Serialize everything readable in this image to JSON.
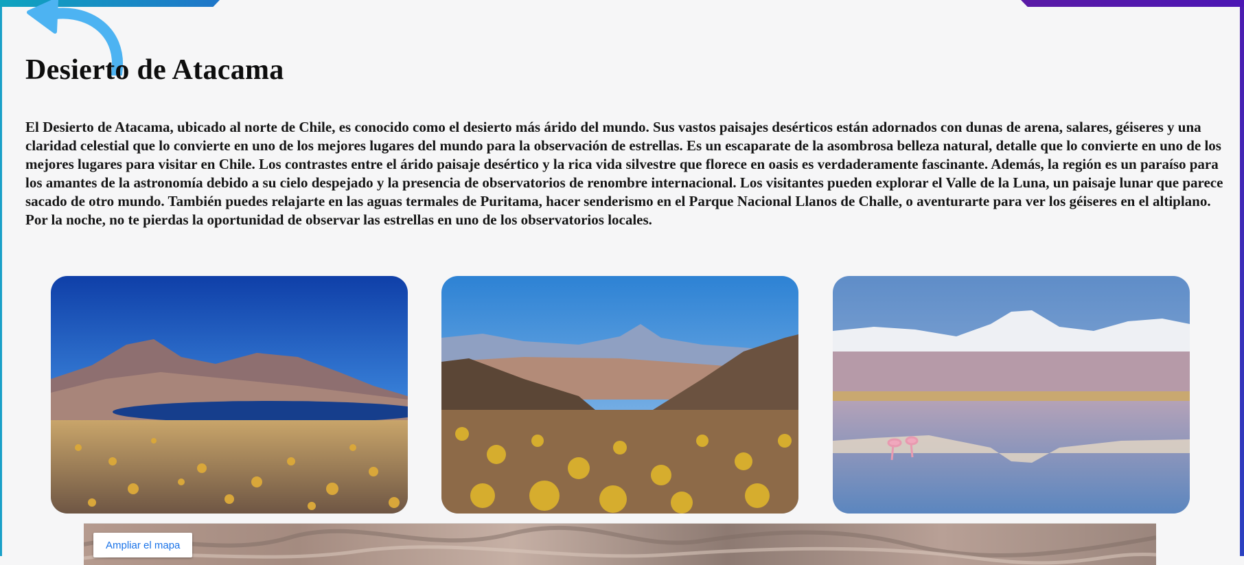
{
  "page": {
    "title": "Desierto de Atacama",
    "description": "El Desierto de Atacama, ubicado al norte de Chile, es conocido como el desierto más árido del mundo. Sus vastos paisajes desérticos están adornados con dunas de arena, salares, géiseres y una claridad celestial que lo convierte en uno de los mejores lugares del mundo para la observación de estrellas. Es un escaparate de la asombrosa belleza natural, detalle que lo convierte en uno de los mejores lugares para visitar en Chile. Los contrastes entre el árido paisaje desértico y la rica vida silvestre que florece en oasis es verdaderamente fascinante. Además, la región es un paraíso para los amantes de la astronomía debido a su cielo despejado y la presencia de observatorios de renombre internacional. Los visitantes pueden explorar el Valle de la Luna, un paisaje lunar que parece sacado de otro mundo. También puedes relajarte en las aguas termales de Puritama, hacer senderismo en el Parque Nacional Llanos de Challe, o aventurarte para ver los géiseres en el altiplano. Por la noche, no te pierdas la oportunidad de observar las estrellas en uno de los observatorios locales."
  },
  "navigation": {
    "back_icon": "curved-back-arrow-icon"
  },
  "map": {
    "enlarge_label": "Ampliar el mapa"
  },
  "colors": {
    "accent_cyan": "#1aa0c8",
    "accent_purple": "#4c1bb0",
    "arrow_blue": "#4db3f2",
    "map_link": "#1a73e8"
  }
}
